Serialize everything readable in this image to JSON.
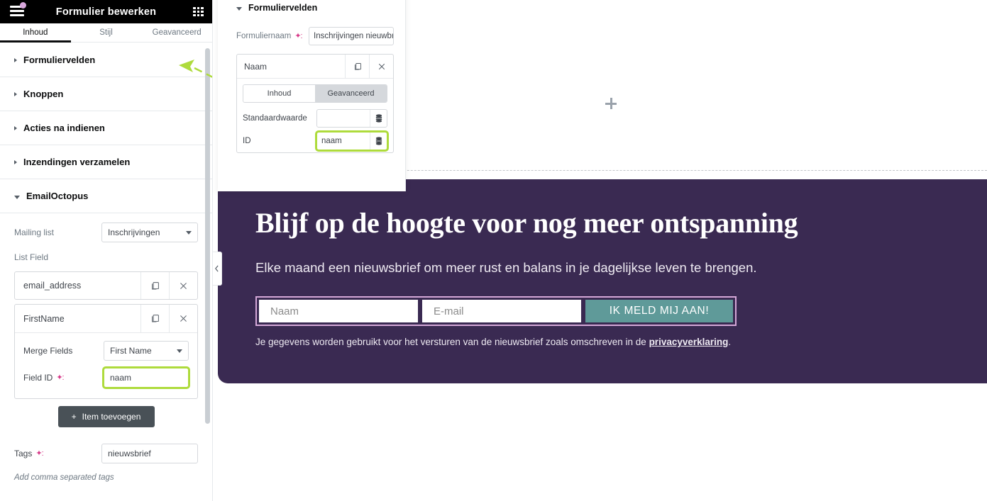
{
  "sidebar": {
    "header": {
      "title": "Formulier bewerken",
      "menu_icon": "hamburger-icon",
      "apps_icon": "grid-apps-icon"
    },
    "tabs": [
      {
        "label": "Inhoud",
        "active": true
      },
      {
        "label": "Stijl",
        "active": false
      },
      {
        "label": "Geavanceerd",
        "active": false
      }
    ],
    "sections": [
      {
        "label": "Formuliervelden",
        "open": false
      },
      {
        "label": "Knoppen",
        "open": false
      },
      {
        "label": "Acties na indienen",
        "open": false
      },
      {
        "label": "Inzendingen verzamelen",
        "open": false
      },
      {
        "label": "EmailOctopus",
        "open": true
      }
    ],
    "emailoctopus": {
      "mailing_list_label": "Mailing list",
      "mailing_list_value": "Inschrijvingen",
      "list_field_label": "List Field",
      "items": [
        {
          "title": "email_address",
          "open": false
        },
        {
          "title": "FirstName",
          "open": true,
          "merge_fields_label": "Merge Fields",
          "merge_fields_value": "First Name",
          "field_id_label": "Field ID",
          "field_id_value": "naam",
          "field_id_highlighted": true
        }
      ],
      "add_item_label": "Item toevoegen",
      "tags_label": "Tags",
      "tags_value": "nieuwsbrief",
      "tags_help": "Add comma separated tags"
    }
  },
  "float_panel": {
    "section_label": "Formuliervelden",
    "form_name_label": "Formuliernaam",
    "form_name_value": "Inschrijvingen nieuwbrief",
    "field_card": {
      "title": "Naam",
      "duplicate_icon": "duplicate-icon",
      "remove_icon": "close-icon",
      "tabs": [
        {
          "label": "Inhoud",
          "active": false
        },
        {
          "label": "Geavanceerd",
          "active": true
        }
      ],
      "rows": [
        {
          "label": "Standaardwaarde",
          "value": "",
          "highlighted": false
        },
        {
          "label": "ID",
          "value": "naam",
          "highlighted": true
        }
      ]
    }
  },
  "canvas": {
    "collapse_icon": "chevron-left-icon",
    "add_section_icon": "plus-icon",
    "hero": {
      "title": "Blijf op de hoogte voor nog meer ontspanning",
      "subtitle": "Elke maand een nieuwsbrief om meer rust en balans in je dagelijkse leven te brengen.",
      "name_placeholder": "Naam",
      "email_placeholder": "E-mail",
      "submit_label": "IK MELD MIJ AAN!",
      "legal_prefix": "Je gegevens worden gebruikt voor het versturen van de nieuwsbrief zoals omschreven in de ",
      "legal_link": "privacyverklaring",
      "legal_suffix": "."
    },
    "image_alt": "lavender-cosmetics-photo"
  },
  "colors": {
    "hero_bg": "#3a2a52",
    "hero_button": "#5f9a99",
    "hero_border": "#d5a8d8",
    "highlight": "#aedb3c",
    "dynamic_tag": "#d73a89",
    "header_bg": "#000000"
  }
}
